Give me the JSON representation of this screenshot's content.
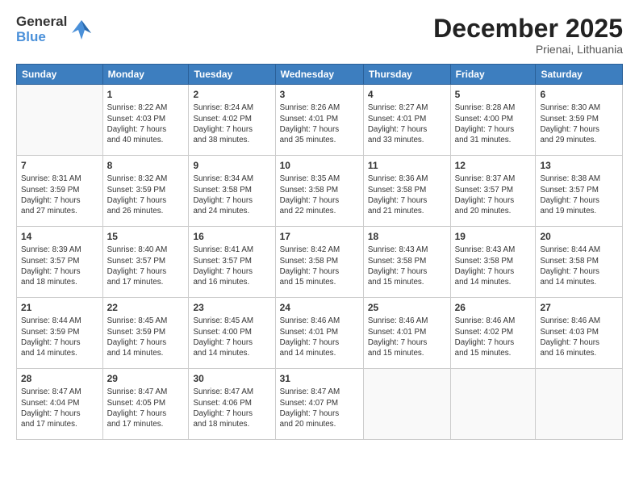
{
  "header": {
    "logo_general": "General",
    "logo_blue": "Blue",
    "month": "December 2025",
    "location": "Prienai, Lithuania"
  },
  "days_of_week": [
    "Sunday",
    "Monday",
    "Tuesday",
    "Wednesday",
    "Thursday",
    "Friday",
    "Saturday"
  ],
  "weeks": [
    [
      {
        "day": "",
        "info": ""
      },
      {
        "day": "1",
        "info": "Sunrise: 8:22 AM\nSunset: 4:03 PM\nDaylight: 7 hours\nand 40 minutes."
      },
      {
        "day": "2",
        "info": "Sunrise: 8:24 AM\nSunset: 4:02 PM\nDaylight: 7 hours\nand 38 minutes."
      },
      {
        "day": "3",
        "info": "Sunrise: 8:26 AM\nSunset: 4:01 PM\nDaylight: 7 hours\nand 35 minutes."
      },
      {
        "day": "4",
        "info": "Sunrise: 8:27 AM\nSunset: 4:01 PM\nDaylight: 7 hours\nand 33 minutes."
      },
      {
        "day": "5",
        "info": "Sunrise: 8:28 AM\nSunset: 4:00 PM\nDaylight: 7 hours\nand 31 minutes."
      },
      {
        "day": "6",
        "info": "Sunrise: 8:30 AM\nSunset: 3:59 PM\nDaylight: 7 hours\nand 29 minutes."
      }
    ],
    [
      {
        "day": "7",
        "info": "Sunrise: 8:31 AM\nSunset: 3:59 PM\nDaylight: 7 hours\nand 27 minutes."
      },
      {
        "day": "8",
        "info": "Sunrise: 8:32 AM\nSunset: 3:59 PM\nDaylight: 7 hours\nand 26 minutes."
      },
      {
        "day": "9",
        "info": "Sunrise: 8:34 AM\nSunset: 3:58 PM\nDaylight: 7 hours\nand 24 minutes."
      },
      {
        "day": "10",
        "info": "Sunrise: 8:35 AM\nSunset: 3:58 PM\nDaylight: 7 hours\nand 22 minutes."
      },
      {
        "day": "11",
        "info": "Sunrise: 8:36 AM\nSunset: 3:58 PM\nDaylight: 7 hours\nand 21 minutes."
      },
      {
        "day": "12",
        "info": "Sunrise: 8:37 AM\nSunset: 3:57 PM\nDaylight: 7 hours\nand 20 minutes."
      },
      {
        "day": "13",
        "info": "Sunrise: 8:38 AM\nSunset: 3:57 PM\nDaylight: 7 hours\nand 19 minutes."
      }
    ],
    [
      {
        "day": "14",
        "info": "Sunrise: 8:39 AM\nSunset: 3:57 PM\nDaylight: 7 hours\nand 18 minutes."
      },
      {
        "day": "15",
        "info": "Sunrise: 8:40 AM\nSunset: 3:57 PM\nDaylight: 7 hours\nand 17 minutes."
      },
      {
        "day": "16",
        "info": "Sunrise: 8:41 AM\nSunset: 3:57 PM\nDaylight: 7 hours\nand 16 minutes."
      },
      {
        "day": "17",
        "info": "Sunrise: 8:42 AM\nSunset: 3:58 PM\nDaylight: 7 hours\nand 15 minutes."
      },
      {
        "day": "18",
        "info": "Sunrise: 8:43 AM\nSunset: 3:58 PM\nDaylight: 7 hours\nand 15 minutes."
      },
      {
        "day": "19",
        "info": "Sunrise: 8:43 AM\nSunset: 3:58 PM\nDaylight: 7 hours\nand 14 minutes."
      },
      {
        "day": "20",
        "info": "Sunrise: 8:44 AM\nSunset: 3:58 PM\nDaylight: 7 hours\nand 14 minutes."
      }
    ],
    [
      {
        "day": "21",
        "info": "Sunrise: 8:44 AM\nSunset: 3:59 PM\nDaylight: 7 hours\nand 14 minutes."
      },
      {
        "day": "22",
        "info": "Sunrise: 8:45 AM\nSunset: 3:59 PM\nDaylight: 7 hours\nand 14 minutes."
      },
      {
        "day": "23",
        "info": "Sunrise: 8:45 AM\nSunset: 4:00 PM\nDaylight: 7 hours\nand 14 minutes."
      },
      {
        "day": "24",
        "info": "Sunrise: 8:46 AM\nSunset: 4:01 PM\nDaylight: 7 hours\nand 14 minutes."
      },
      {
        "day": "25",
        "info": "Sunrise: 8:46 AM\nSunset: 4:01 PM\nDaylight: 7 hours\nand 15 minutes."
      },
      {
        "day": "26",
        "info": "Sunrise: 8:46 AM\nSunset: 4:02 PM\nDaylight: 7 hours\nand 15 minutes."
      },
      {
        "day": "27",
        "info": "Sunrise: 8:46 AM\nSunset: 4:03 PM\nDaylight: 7 hours\nand 16 minutes."
      }
    ],
    [
      {
        "day": "28",
        "info": "Sunrise: 8:47 AM\nSunset: 4:04 PM\nDaylight: 7 hours\nand 17 minutes."
      },
      {
        "day": "29",
        "info": "Sunrise: 8:47 AM\nSunset: 4:05 PM\nDaylight: 7 hours\nand 17 minutes."
      },
      {
        "day": "30",
        "info": "Sunrise: 8:47 AM\nSunset: 4:06 PM\nDaylight: 7 hours\nand 18 minutes."
      },
      {
        "day": "31",
        "info": "Sunrise: 8:47 AM\nSunset: 4:07 PM\nDaylight: 7 hours\nand 20 minutes."
      },
      {
        "day": "",
        "info": ""
      },
      {
        "day": "",
        "info": ""
      },
      {
        "day": "",
        "info": ""
      }
    ]
  ]
}
